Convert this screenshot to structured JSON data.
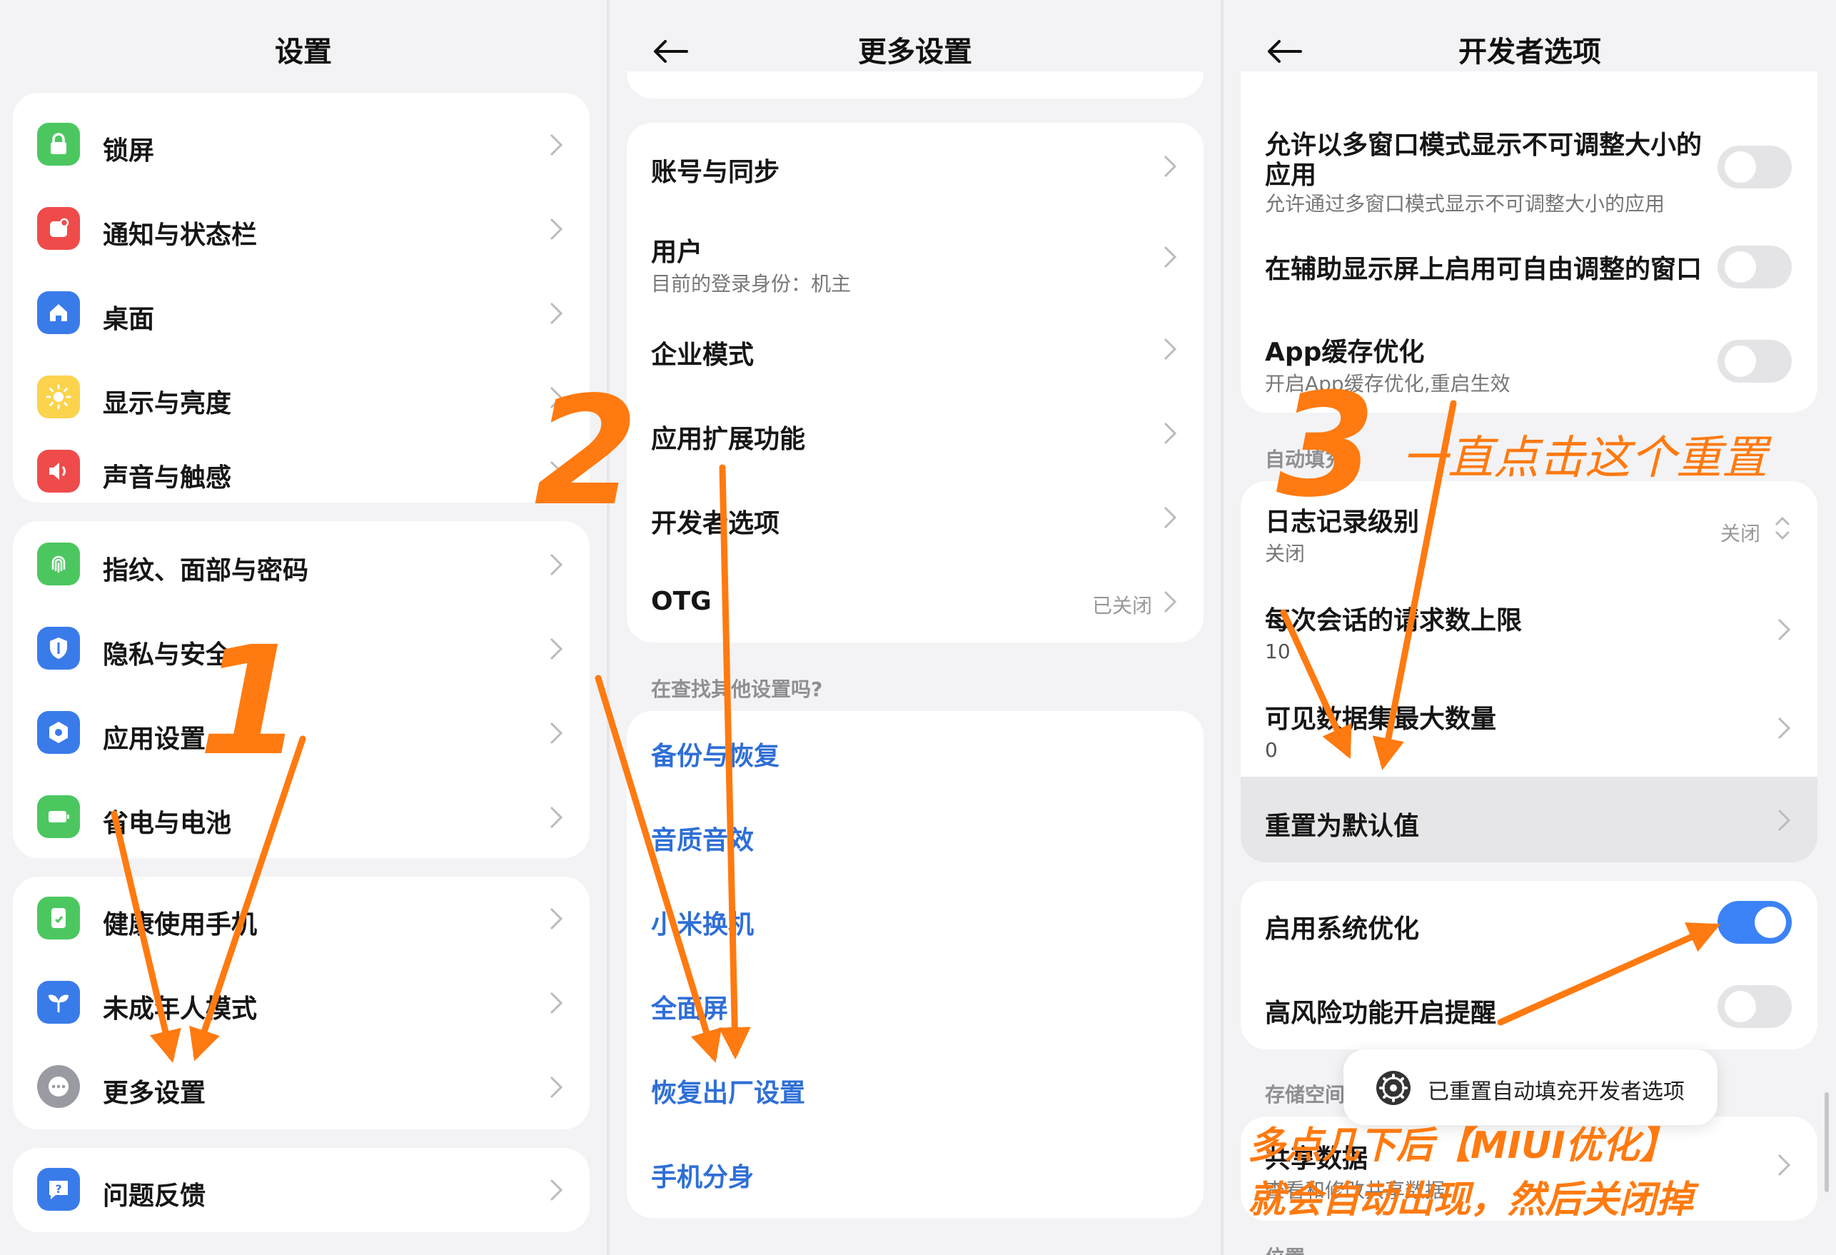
{
  "panel1": {
    "title": "设置",
    "groups": [
      [
        "锁屏",
        "通知与状态栏",
        "桌面",
        "显示与亮度",
        "声音与触感"
      ],
      [
        "指纹、面部与密码",
        "隐私与安全",
        "应用设置",
        "省电与电池"
      ],
      [
        "健康使用手机",
        "未成年人模式",
        "更多设置"
      ],
      [
        "问题反馈"
      ]
    ]
  },
  "panel2": {
    "title": "更多设置",
    "items": {
      "account": "账号与同步",
      "user": "用户",
      "user_sub": "目前的登录身份：机主",
      "enterprise": "企业模式",
      "app_ext": "应用扩展功能",
      "developer": "开发者选项",
      "otg": "OTG",
      "otg_value": "已关闭"
    },
    "section": "在查找其他设置吗?",
    "links": [
      "备份与恢复",
      "音质音效",
      "小米换机",
      "全面屏",
      "恢复出厂设置",
      "手机分身"
    ]
  },
  "panel3": {
    "title": "开发者选项",
    "multiwindow_label_1": "允许以多窗口模式显示不可调整大小的",
    "multiwindow_label_2": "应用",
    "multiwindow_sub": "允许通过多窗口模式显示不可调整大小的应用",
    "freeform": "在辅助显示屏上启用可自由调整的窗口",
    "app_cache": "App缓存优化",
    "app_cache_sub": "开启App缓存优化,重启生效",
    "autofill_section": "自动填充",
    "log_level": "日志记录级别",
    "log_level_sub": "关闭",
    "log_level_value": "关闭",
    "max_requests": "每次会话的请求数上限",
    "max_requests_value": "10",
    "max_datasets": "可见数据集最大数量",
    "max_datasets_value": "0",
    "reset_default": "重置为默认值",
    "system_opt": "启用系统优化",
    "high_risk": "高风险功能开启提醒",
    "storage_section": "存储空间",
    "shared_data": "共享数据",
    "shared_data_sub": "查看和修改共享数据",
    "position_section": "位置",
    "toast": "已重置自动填充开发者选项"
  },
  "annotations": {
    "step1": "1",
    "step2": "2",
    "step3": "3",
    "step3_text": "一直点击这个重置",
    "note_line1": "多点几下后【MIUI优化】",
    "note_line2": "就会自动出现，然后关闭掉"
  },
  "colors": {
    "accent": "#ff7a10",
    "link": "#2f6fd6",
    "toggle_on": "#3b82f6"
  }
}
